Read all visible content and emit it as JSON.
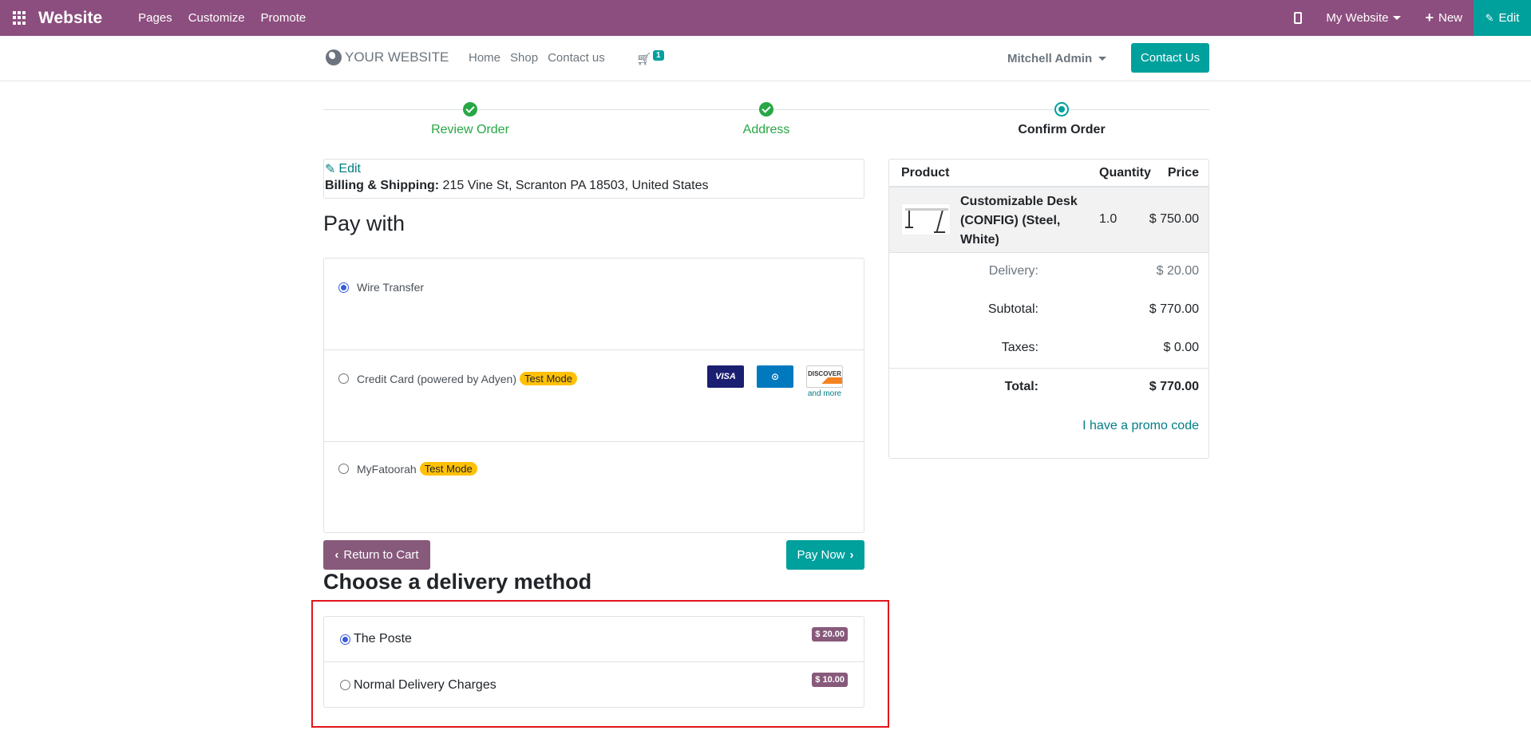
{
  "adminbar": {
    "brand": "Website",
    "menu": [
      "Pages",
      "Customize",
      "Promote"
    ],
    "site_selector": "My Website",
    "new_label": "New",
    "edit_label": "Edit"
  },
  "site": {
    "logo_text": "YOUR WEBSITE",
    "nav": [
      "Home",
      "Shop",
      "Contact us"
    ],
    "cart_count": "1",
    "user": "Mitchell Admin",
    "contact_button": "Contact Us"
  },
  "wizard": {
    "steps": [
      {
        "label": "Review Order",
        "state": "done"
      },
      {
        "label": "Address",
        "state": "done"
      },
      {
        "label": "Confirm Order",
        "state": "current"
      }
    ]
  },
  "address": {
    "edit_label": "Edit",
    "heading": "Billing & Shipping:",
    "value": "215 Vine St, Scranton PA 18503, United States"
  },
  "payment": {
    "title": "Pay with",
    "methods": [
      {
        "label": "Wire Transfer",
        "checked": true,
        "badge": ""
      },
      {
        "label": "Credit Card (powered by Adyen)",
        "checked": false,
        "badge": "Test Mode"
      },
      {
        "label": "MyFatoorah",
        "checked": false,
        "badge": "Test Mode"
      }
    ],
    "card_logos": [
      "VISA",
      "Diners Club",
      "DISCOVER"
    ],
    "and_more": "and more"
  },
  "buttons": {
    "return": "Return to Cart",
    "pay_now": "Pay Now"
  },
  "delivery": {
    "title": "Choose a delivery method",
    "options": [
      {
        "label": "The Poste",
        "price": "$ 20.00",
        "checked": true
      },
      {
        "label": "Normal Delivery Charges",
        "price": "$ 10.00",
        "checked": false
      }
    ]
  },
  "summary": {
    "headers": [
      "Product",
      "Quantity",
      "Price"
    ],
    "product": {
      "name": "Customizable Desk (CONFIG) (Steel, White)",
      "qty": "1.0",
      "price": "$ 750.00"
    },
    "delivery_label": "Delivery:",
    "delivery_value": "$ 20.00",
    "subtotal_label": "Subtotal:",
    "subtotal_value": "$ 770.00",
    "taxes_label": "Taxes:",
    "taxes_value": "$ 0.00",
    "total_label": "Total:",
    "total_value": "$ 770.00",
    "promo": "I have a promo code"
  }
}
